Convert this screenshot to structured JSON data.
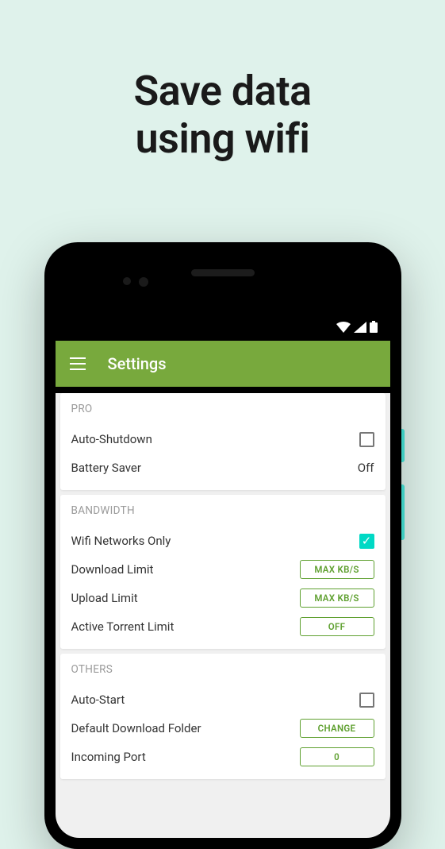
{
  "headline_line1": "Save data",
  "headline_line2": "using wifi",
  "app_title": "Settings",
  "sections": {
    "pro": {
      "title": "PRO",
      "auto_shutdown": "Auto-Shutdown",
      "battery_saver": "Battery Saver",
      "battery_saver_value": "Off"
    },
    "bandwidth": {
      "title": "BANDWIDTH",
      "wifi_only": "Wifi Networks Only",
      "download_limit": "Download Limit",
      "download_limit_btn": "MAX KB/S",
      "upload_limit": "Upload Limit",
      "upload_limit_btn": "MAX KB/S",
      "active_torrent": "Active Torrent Limit",
      "active_torrent_btn": "OFF"
    },
    "others": {
      "title": "OTHERS",
      "auto_start": "Auto-Start",
      "default_folder": "Default Download Folder",
      "default_folder_btn": "CHANGE",
      "incoming_port": "Incoming Port",
      "incoming_port_btn": "0"
    }
  }
}
